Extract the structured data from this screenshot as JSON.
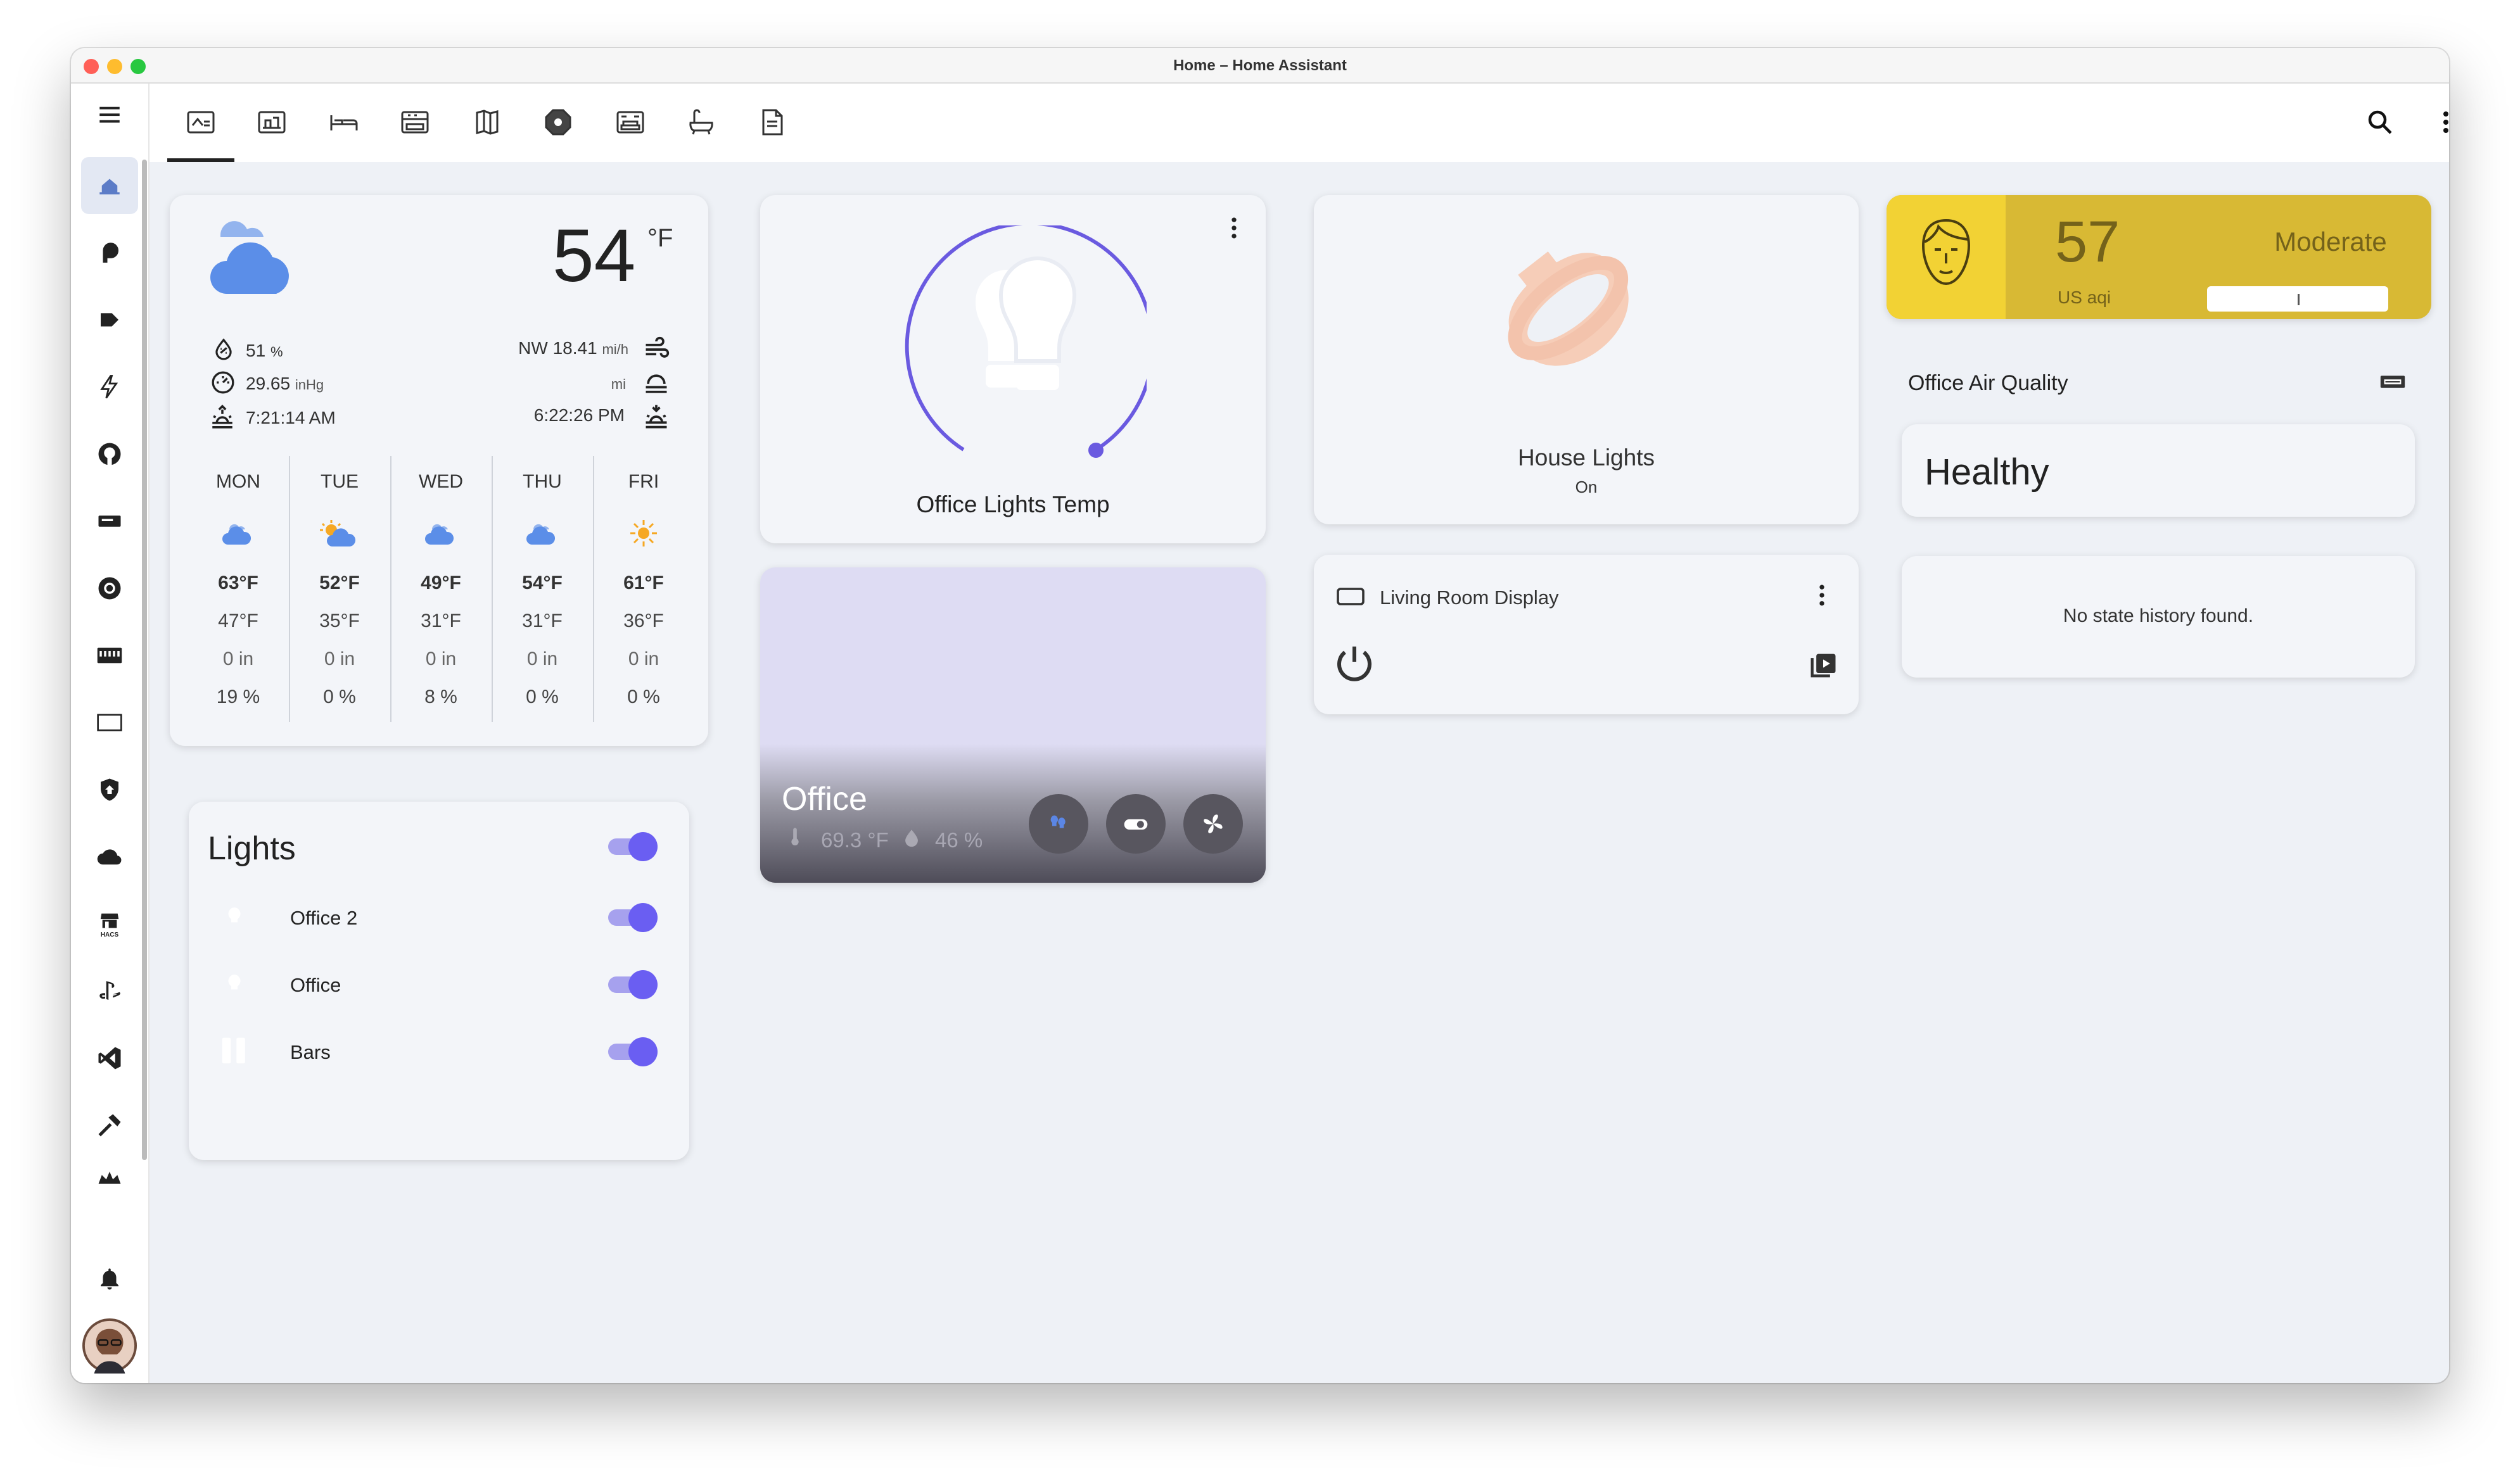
{
  "window": {
    "title": "Home – Home Assistant"
  },
  "sidebar": {
    "menu_icon": "menu-icon",
    "items": [
      {
        "icon": "overview-icon",
        "active": true
      },
      {
        "icon": "energy-icon"
      },
      {
        "icon": "media-icon"
      },
      {
        "icon": "lightning-icon"
      },
      {
        "icon": "github-icon"
      },
      {
        "icon": "display-icon"
      },
      {
        "icon": "circle-icon"
      },
      {
        "icon": "keyboard-icon"
      },
      {
        "icon": "rectangle-icon"
      },
      {
        "icon": "shield-icon"
      },
      {
        "icon": "cloud-icon"
      },
      {
        "icon": "hacs-icon",
        "label": "HACS"
      },
      {
        "icon": "playstation-icon"
      },
      {
        "icon": "vscode-icon"
      },
      {
        "icon": "hammer-icon"
      },
      {
        "icon": "crown-icon"
      }
    ],
    "notifications_icon": "bell-icon",
    "avatar": "user-avatar"
  },
  "toolbar": {
    "tabs": [
      "home-tab-icon",
      "office-tab-icon",
      "bedroom-tab-icon",
      "kitchen-tab-icon",
      "map-tab-icon",
      "security-tab-icon",
      "living-room-tab-icon",
      "bathroom-tab-icon",
      "notes-tab-icon"
    ],
    "active_tab": 0,
    "search_icon": "search-icon",
    "more_icon": "more-vert-icon"
  },
  "weather": {
    "temp": "54",
    "unit": "°F",
    "humidity": "51",
    "humidity_unit": "%",
    "pressure": "29.65",
    "pressure_unit": "inHg",
    "sunrise": "7:21:14 AM",
    "wind": "NW 18.41",
    "wind_unit": "mi/h",
    "visibility_unit": "mi",
    "sunset": "6:22:26 PM",
    "forecast": [
      {
        "day": "MON",
        "icon": "partly-cloudy-icon",
        "high": "63°F",
        "low": "47°F",
        "precip": "0 in",
        "prob": "19 %"
      },
      {
        "day": "TUE",
        "icon": "sun-cloud-icon",
        "high": "52°F",
        "low": "35°F",
        "precip": "0 in",
        "prob": "0 %"
      },
      {
        "day": "WED",
        "icon": "partly-cloudy-icon",
        "high": "49°F",
        "low": "31°F",
        "precip": "0 in",
        "prob": "8 %"
      },
      {
        "day": "THU",
        "icon": "partly-cloudy-icon",
        "high": "54°F",
        "low": "31°F",
        "precip": "0 in",
        "prob": "0 %"
      },
      {
        "day": "FRI",
        "icon": "sunny-icon",
        "high": "61°F",
        "low": "36°F",
        "precip": "0 in",
        "prob": "0 %"
      }
    ]
  },
  "lights_card": {
    "title": "Lights",
    "items": [
      {
        "name": "Office 2",
        "on": true
      },
      {
        "name": "Office",
        "on": true
      },
      {
        "name": "Bars",
        "on": true
      }
    ]
  },
  "office_lights_temp": {
    "name": "Office Lights Temp"
  },
  "office_room": {
    "name": "Office",
    "temperature": "69.3 °F",
    "humidity": "46 %"
  },
  "house_lights": {
    "name": "House Lights",
    "state": "On"
  },
  "living_room_display": {
    "name": "Living Room Display"
  },
  "air_quality": {
    "value": "57",
    "unit": "US aqi",
    "level": "Moderate",
    "accent": "#d8b934",
    "title": "Office Air Quality",
    "state": "Healthy",
    "history": "No state history found."
  }
}
